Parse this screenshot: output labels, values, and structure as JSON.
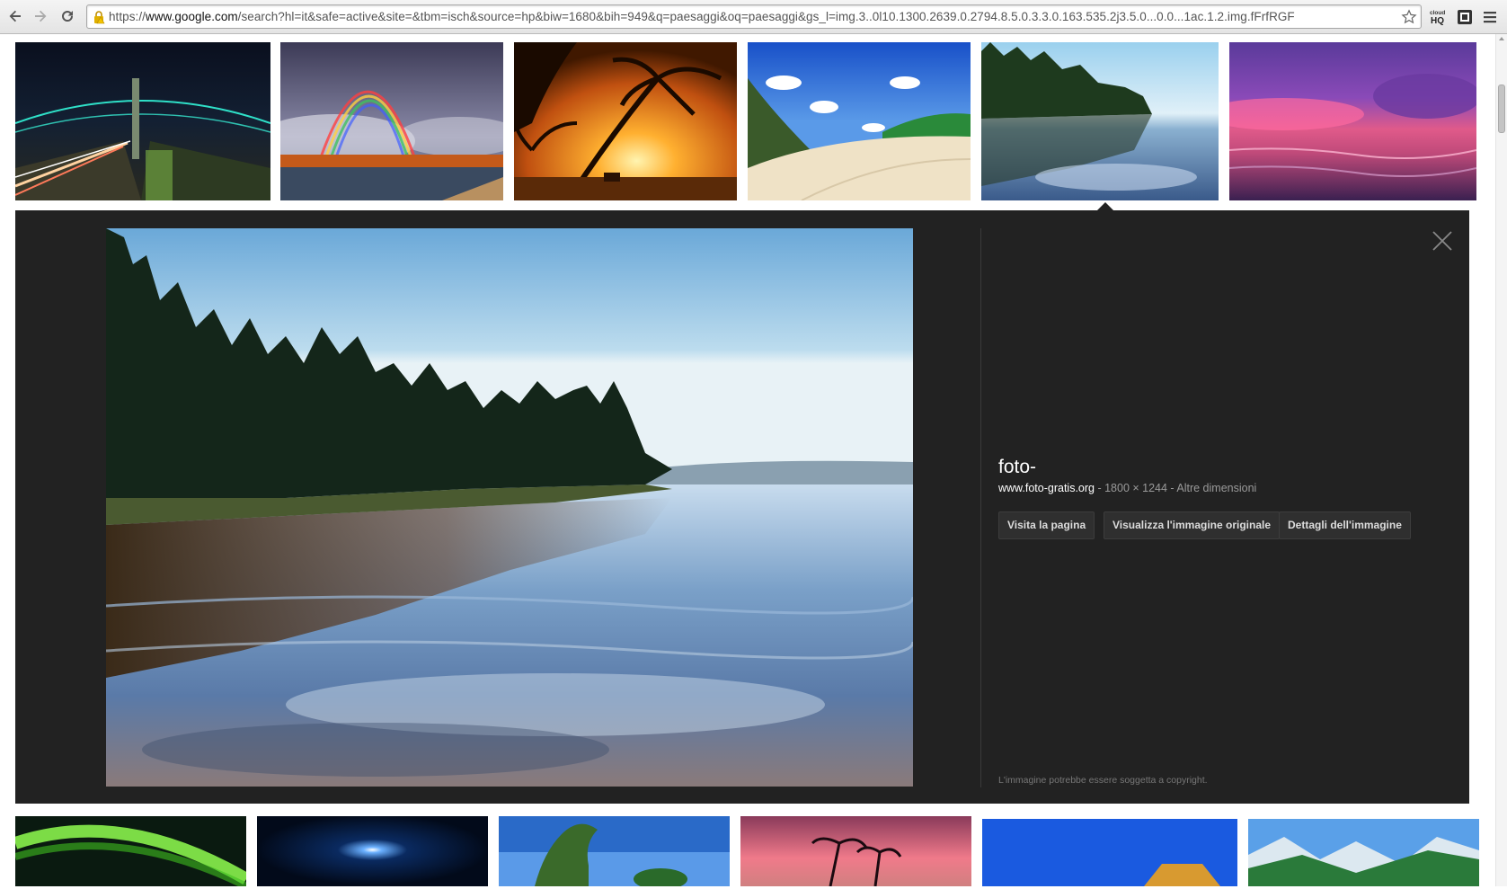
{
  "browser": {
    "url_prefix": "https://",
    "url_domain": "www.google.com",
    "url_rest": "/search?hl=it&safe=active&site=&tbm=isch&source=hp&biw=1680&bih=949&q=paesaggi&oq=paesaggi&gs_l=img.3..0l10.1300.2639.0.2794.8.5.0.3.3.0.163.535.2j3.5.0...0.0...1ac.1.2.img.fFrfRGF",
    "extension_label": "HQ"
  },
  "thumbnails_row1": [
    {
      "name": "night-bridge-thumbnail"
    },
    {
      "name": "rainbow-thumbnail"
    },
    {
      "name": "palm-sunset-thumbnail"
    },
    {
      "name": "dunes-thumbnail"
    },
    {
      "name": "lake-forest-thumbnail"
    },
    {
      "name": "purple-sea-thumbnail"
    }
  ],
  "thumbnails_row2": [
    {
      "name": "aurora-thumbnail"
    },
    {
      "name": "night-star-thumbnail"
    },
    {
      "name": "tree-sky-thumbnail"
    },
    {
      "name": "pink-palms-thumbnail"
    },
    {
      "name": "blue-sky-roof-thumbnail"
    },
    {
      "name": "fjord-mountains-thumbnail"
    }
  ],
  "preview": {
    "title": "foto-",
    "site": "www.foto-gratis.org",
    "dimensions": " - 1800 × 1244 - ",
    "more_sizes": "Altre dimensioni",
    "buttons": {
      "visit": "Visita la pagina",
      "view_original": "Visualizza l'immagine originale",
      "details": "Dettagli dell'immagine"
    },
    "copyright_note": "L'immagine potrebbe essere soggetta a copyright."
  },
  "colors": {
    "panel_bg": "#222222",
    "button_bg": "#2f2f2f",
    "text_muted": "#9a9a9a"
  }
}
